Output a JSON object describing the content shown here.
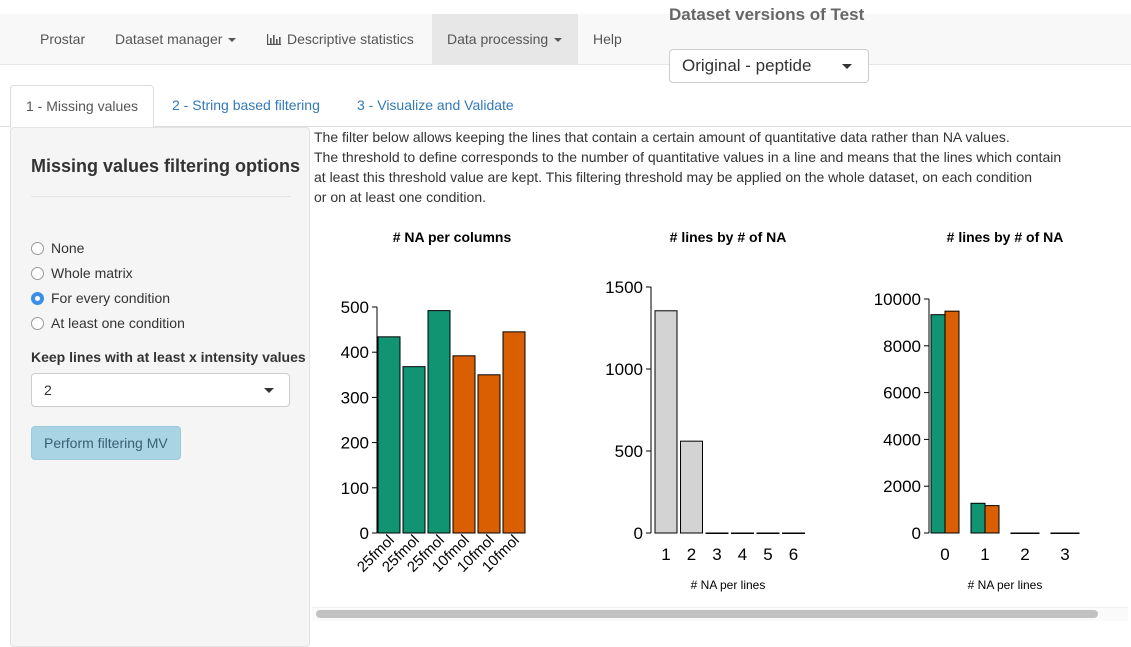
{
  "navbar": {
    "brand": "Prostar",
    "dataset_manager": "Dataset manager",
    "descriptive_statistics": "Descriptive statistics",
    "data_processing": "Data processing",
    "help": "Help"
  },
  "dataset_versions": {
    "title": "Dataset versions of Test",
    "selected": "Original - peptide"
  },
  "tabs": [
    "1 - Missing values",
    "2 - String based filtering",
    "3 - Visualize and Validate"
  ],
  "sidebar": {
    "title": "Missing values filtering options",
    "radio_options": [
      "None",
      "Whole matrix",
      "For every condition",
      "At least one condition"
    ],
    "selected_option": "For every condition",
    "threshold_label": "Keep lines with at least x intensity values",
    "threshold_value": "2",
    "perform_button": "Perform filtering MV"
  },
  "description": [
    "The filter below allows keeping the lines that contain a certain amount of quantitative data rather than NA values.",
    "The threshold to define corresponds to the number of quantitative values in a line and means that the lines which contain",
    "at least this threshold value are kept. This filtering threshold may be applied on the whole dataset, on each condition",
    "or on at least one condition."
  ],
  "colors": {
    "condition1": "#119472",
    "condition2": "#d95f02",
    "gray": "#d3d3d3",
    "link": "#337ab7"
  },
  "chart_data": [
    {
      "type": "bar",
      "title": "# NA per columns",
      "categories": [
        "25fmol",
        "25fmol",
        "25fmol",
        "10fmol",
        "10fmol",
        "10fmol"
      ],
      "values": [
        434,
        368,
        492,
        392,
        350,
        445
      ],
      "bar_colors": [
        "#119472",
        "#119472",
        "#119472",
        "#d95f02",
        "#d95f02",
        "#d95f02"
      ],
      "ylim": [
        0,
        500
      ],
      "yticks": [
        0,
        100,
        200,
        300,
        400,
        500
      ],
      "xlabel": "",
      "ylabel": ""
    },
    {
      "type": "bar",
      "title": "# lines by # of NA",
      "categories": [
        "1",
        "2",
        "3",
        "4",
        "5",
        "6"
      ],
      "values": [
        1355,
        560,
        0,
        0,
        0,
        0
      ],
      "ylim": [
        0,
        1500
      ],
      "yticks": [
        0,
        500,
        1000,
        1500
      ],
      "xlabel": "# NA per lines",
      "ylabel": ""
    },
    {
      "type": "bar",
      "title": "# lines by # of NA",
      "categories": [
        "0",
        "1",
        "2",
        "3"
      ],
      "series": [
        {
          "values": [
            9330,
            1270,
            0,
            0
          ],
          "color": "#119472"
        },
        {
          "values": [
            9480,
            1170,
            0,
            0
          ],
          "color": "#d95f02"
        }
      ],
      "ylim": [
        0,
        10000
      ],
      "yticks": [
        0,
        2000,
        4000,
        6000,
        8000,
        10000
      ],
      "xlabel": "# NA per lines",
      "ylabel": ""
    }
  ]
}
